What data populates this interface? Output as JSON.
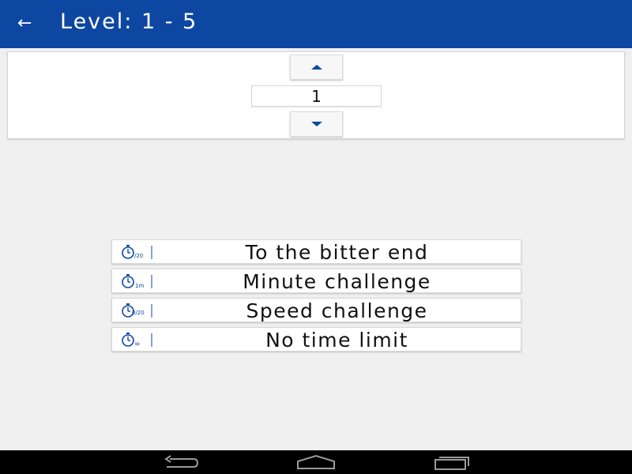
{
  "appbar": {
    "back_icon": "arrow-left-icon",
    "title": "Level: 1 - 5"
  },
  "level_picker": {
    "value": "1",
    "increment_icon": "triangle-up-icon",
    "decrement_icon": "triangle-down-icon"
  },
  "modes": [
    {
      "label": "To the bitter end",
      "icon": "stopwatch-bitter-end-icon",
      "icon_text": "/20"
    },
    {
      "label": "Minute challenge",
      "icon": "stopwatch-minute-icon",
      "icon_text": "1m"
    },
    {
      "label": "Speed challenge",
      "icon": "stopwatch-speed-icon",
      "icon_text": "0/20"
    },
    {
      "label": "No time limit",
      "icon": "stopwatch-infinity-icon",
      "icon_text": "∞"
    }
  ],
  "navbar": {
    "back_icon": "nav-back-icon",
    "home_icon": "nav-home-icon",
    "recents_icon": "nav-recents-icon"
  },
  "colors": {
    "primary": "#0d47a1",
    "background": "#f0f0f0",
    "navbar": "#000000"
  }
}
